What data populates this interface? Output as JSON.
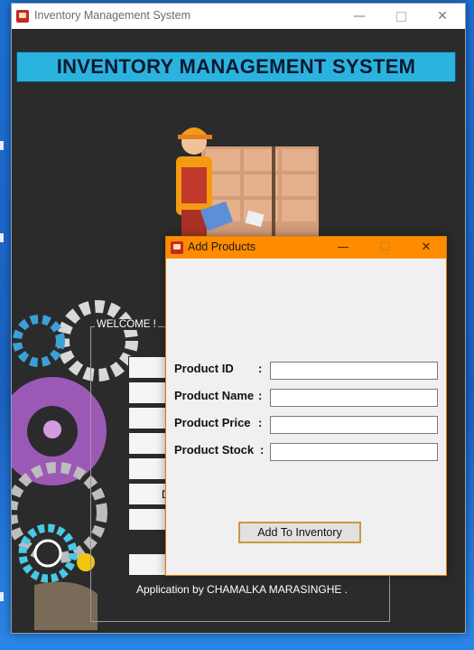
{
  "main_window": {
    "title": "Inventory Management System",
    "controls": {
      "minimize": "—",
      "maximize": "",
      "close": "✕"
    },
    "banner_text": "INVENTORY MANAGEMENT SYSTEM",
    "welcome": {
      "legend": "WELCOME !",
      "visible_button_fragment": "D",
      "credit": "Application by CHAMALKA MARASINGHE ."
    }
  },
  "dialog": {
    "title": "Add Products",
    "controls": {
      "minimize": "—",
      "maximize": "☐",
      "close": "✕"
    },
    "fields": [
      {
        "label": "Product ID",
        "colon": ":",
        "value": ""
      },
      {
        "label": "Product Name",
        "colon": ":",
        "value": ""
      },
      {
        "label": "Product Price",
        "colon": ":",
        "value": ""
      },
      {
        "label": "Product Stock",
        "colon": ":",
        "value": ""
      }
    ],
    "submit_label": "Add To Inventory"
  },
  "colors": {
    "dialog_titlebar": "#ff8c00",
    "banner": "#2bb3e0",
    "client_bg": "#2b2b2b"
  }
}
